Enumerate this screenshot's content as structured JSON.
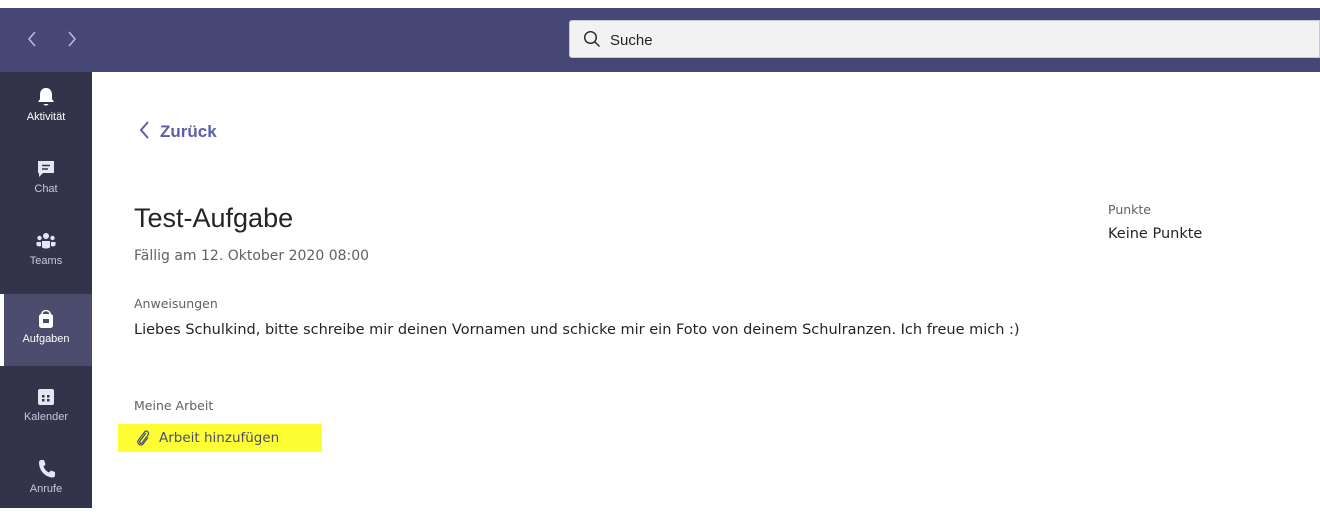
{
  "search": {
    "placeholder": "Suche"
  },
  "sidebar": {
    "items": [
      {
        "label": "Aktivität",
        "icon": "bell-icon"
      },
      {
        "label": "Chat",
        "icon": "chat-icon"
      },
      {
        "label": "Teams",
        "icon": "teams-icon"
      },
      {
        "label": "Aufgaben",
        "icon": "assignments-icon",
        "active": true
      },
      {
        "label": "Kalender",
        "icon": "calendar-icon"
      },
      {
        "label": "Anrufe",
        "icon": "phone-icon"
      }
    ]
  },
  "main": {
    "back_label": "Zurück",
    "title": "Test-Aufgabe",
    "due": "Fällig am 12. Oktober 2020 08:00",
    "instructions_label": "Anweisungen",
    "instructions_text": "Liebes Schulkind, bitte schreibe mir deinen Vornamen und schicke mir ein Foto von deinem Schulranzen. Ich freue mich :)",
    "my_work_label": "Meine Arbeit",
    "add_work_label": "Arbeit hinzufügen"
  },
  "points": {
    "label": "Punkte",
    "value": "Keine Punkte"
  },
  "colors": {
    "topbar": "#464775",
    "rail": "#33344a",
    "accent": "#5b5fa8",
    "highlight": "#fdff32"
  }
}
